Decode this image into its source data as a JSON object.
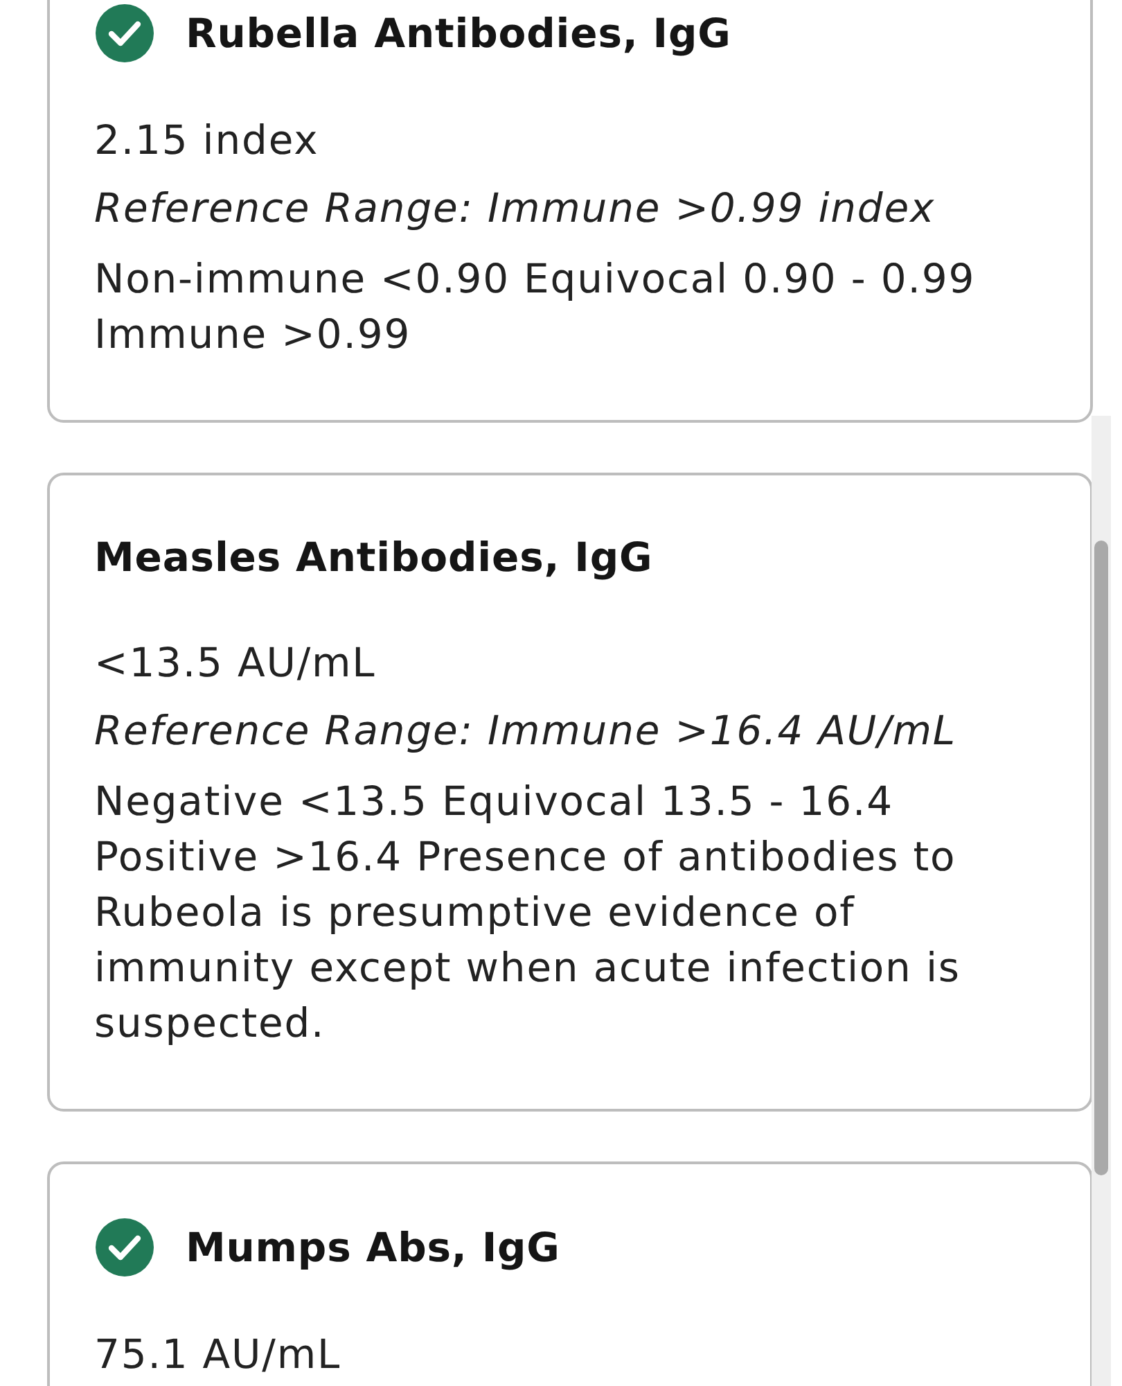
{
  "results": [
    {
      "name": "Rubella Antibodies, IgG",
      "in_range": true,
      "value": "2.15 index",
      "reference_range": "Reference Range: Immune >0.99 index",
      "note": "Non-immune <0.90 Equivocal 0.90 - 0.99 Immune >0.99"
    },
    {
      "name": "Measles Antibodies, IgG",
      "in_range": false,
      "value": "<13.5 AU/mL",
      "reference_range": "Reference Range: Immune >16.4 AU/mL",
      "note": "Negative <13.5 Equivocal 13.5 - 16.4 Positive >16.4 Presence of antibodies to Rubeola is presumptive evidence of immunity except when acute infection is suspected."
    },
    {
      "name": "Mumps Abs, IgG",
      "in_range": true,
      "value": "75.1 AU/mL"
    }
  ]
}
